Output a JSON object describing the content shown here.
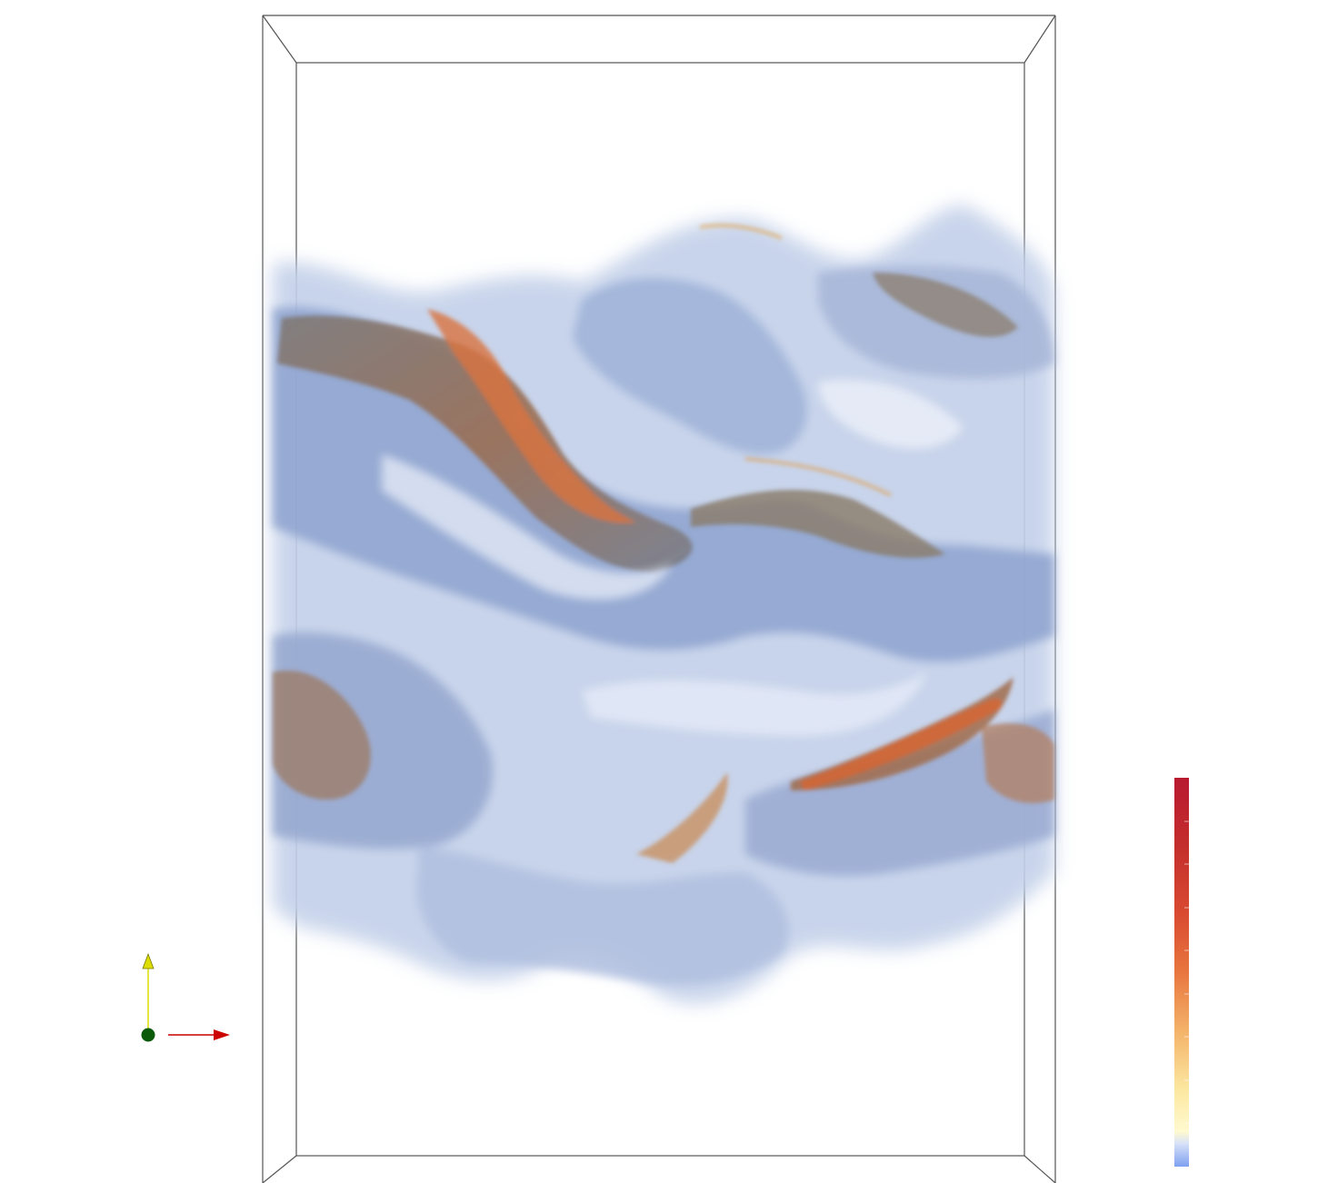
{
  "scene": {
    "background": "#ffffff",
    "volume_colormap": [
      "#6e93e6",
      "#c9d6ee",
      "#fffbd8",
      "#f2a65a",
      "#d8452f",
      "#b20f2e"
    ],
    "bounding_box_color": "#555555"
  },
  "colorbar": {
    "orientation": "vertical",
    "stops": [
      "#7ea0f0",
      "#d8e2f8",
      "#fffad0",
      "#fce7a0",
      "#f4b269",
      "#e8763e",
      "#d94a31",
      "#c42f2c",
      "#b81930"
    ],
    "tick_count": 9
  },
  "orientation_axes": {
    "x_axis_color": "#cc0000",
    "y_axis_color": "#dddd00",
    "origin_color": "#0a5a0a",
    "x_axis_icon": "arrow-right-icon",
    "y_axis_icon": "arrow-up-icon"
  }
}
